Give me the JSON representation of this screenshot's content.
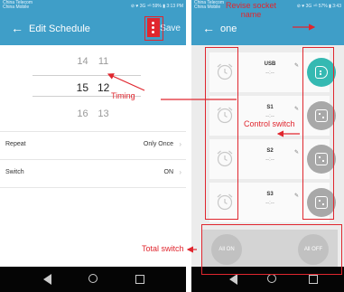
{
  "left_screen": {
    "status_carrier": "China Telecom China Mobile",
    "status_right": "⊘ ♥ 3G ⁴ᴳ 59% ▮ 3:13 PM",
    "back_glyph": "←",
    "title": "Edit Schedule",
    "save_label": "Save",
    "picker_rows": [
      {
        "hour": "14",
        "minute": "11"
      },
      {
        "hour": "15",
        "minute": "12"
      },
      {
        "hour": "16",
        "minute": "13"
      }
    ],
    "settings": [
      {
        "label": "Repeat",
        "value": "Only Once"
      },
      {
        "label": "Switch",
        "value": "ON"
      }
    ]
  },
  "right_screen": {
    "status_carrier": "China Telecom China Mobile",
    "status_right": "⊘ ♥ 3G ⁴ᴳ 57% ▮ 3:43",
    "back_glyph": "←",
    "title": "one",
    "devices": [
      {
        "name": "USB",
        "time": "--:--",
        "state": "on"
      },
      {
        "name": "S1",
        "time": "--:--",
        "state": "off"
      },
      {
        "name": "S2",
        "time": "--:--",
        "state": "off"
      },
      {
        "name": "S3",
        "time": "--:--",
        "state": "off"
      }
    ],
    "all_on_label": "All ON",
    "all_off_label": "All OFF"
  },
  "annotations": {
    "timing": "Timing",
    "control_switch": "Control switch",
    "revise_socket_name_line1": "Revise socket",
    "revise_socket_name_line2": "name",
    "total_switch": "Total switch"
  },
  "colors": {
    "app_bar": "#3f9ec8",
    "annotation_red": "#e0262e",
    "switch_on": "#35b9b2",
    "switch_off": "#a8a8a8"
  }
}
